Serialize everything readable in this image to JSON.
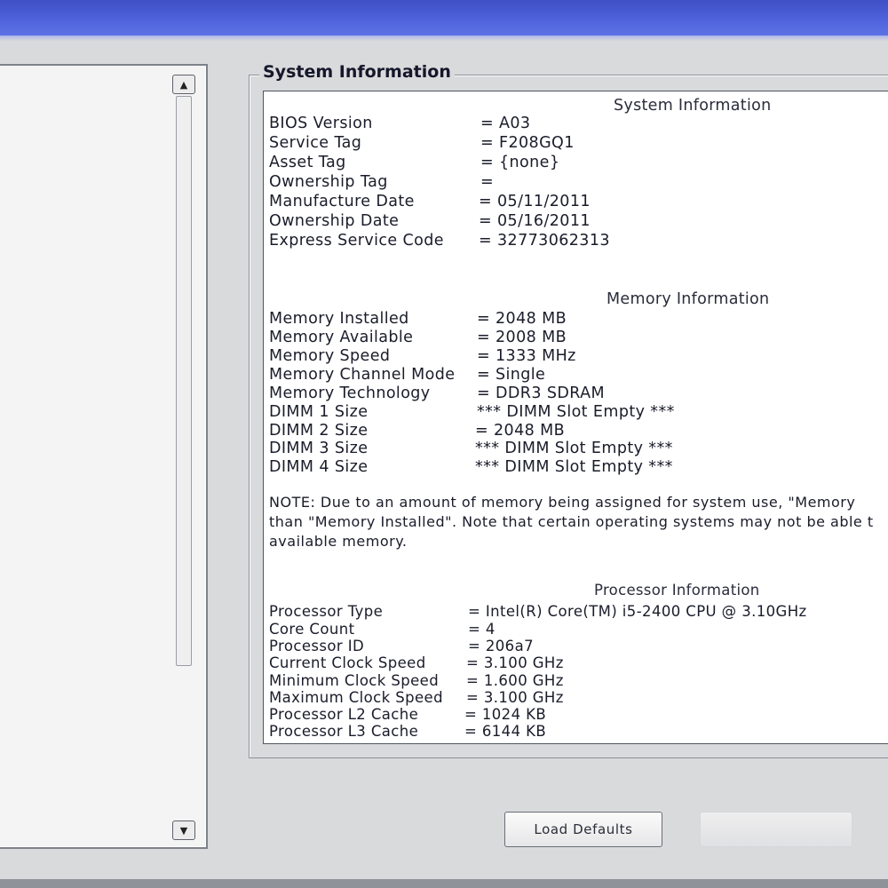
{
  "group": {
    "title": "System Information"
  },
  "system_info": {
    "heading": "System Information",
    "rows": [
      {
        "label": "BIOS Version",
        "value": "= A03"
      },
      {
        "label": "Service Tag",
        "value": "= F208GQ1"
      },
      {
        "label": "Asset Tag",
        "value": "= {none}"
      },
      {
        "label": "Ownership Tag",
        "value": "="
      },
      {
        "label": "Manufacture Date",
        "value": "= 05/11/2011"
      },
      {
        "label": "Ownership Date",
        "value": "= 05/16/2011"
      },
      {
        "label": "Express Service Code",
        "value": "= 32773062313"
      }
    ]
  },
  "memory_info": {
    "heading": "Memory Information",
    "rows": [
      {
        "label": "Memory Installed",
        "value": "= 2048 MB"
      },
      {
        "label": "Memory Available",
        "value": "= 2008 MB"
      },
      {
        "label": "Memory Speed",
        "value": "= 1333 MHz"
      },
      {
        "label": "Memory Channel Mode",
        "value": "= Single"
      },
      {
        "label": "Memory Technology",
        "value": "= DDR3 SDRAM"
      },
      {
        "label": "DIMM 1 Size",
        "value": "*** DIMM Slot Empty ***"
      },
      {
        "label": "DIMM 2 Size",
        "value": "= 2048 MB"
      },
      {
        "label": "DIMM 3 Size",
        "value": "*** DIMM Slot Empty ***"
      },
      {
        "label": "DIMM 4 Size",
        "value": "*** DIMM Slot Empty ***"
      }
    ],
    "note_lines": [
      "NOTE: Due to an amount of memory being assigned for system use, \"Memory",
      "than \"Memory Installed\". Note that certain operating systems may not be able t",
      "available memory."
    ]
  },
  "processor_info": {
    "heading": "Processor Information",
    "rows": [
      {
        "label": "Processor Type",
        "value": "= Intel(R) Core(TM) i5-2400 CPU @ 3.10GHz"
      },
      {
        "label": "Core Count",
        "value": "= 4"
      },
      {
        "label": "Processor ID",
        "value": "= 206a7"
      },
      {
        "label": "Current Clock Speed",
        "value": "= 3.100 GHz"
      },
      {
        "label": "Minimum Clock Speed",
        "value": "= 1.600 GHz"
      },
      {
        "label": "Maximum Clock Speed",
        "value": "= 3.100 GHz"
      },
      {
        "label": "Processor L2 Cache",
        "value": "= 1024 KB"
      },
      {
        "label": "Processor L3 Cache",
        "value": "= 6144 KB"
      }
    ]
  },
  "buttons": {
    "load_defaults": "Load Defaults"
  },
  "scrollbar": {
    "up_icon": "▲",
    "down_icon": "▼"
  },
  "colors": {
    "titlebar": "#4f63dc",
    "panel_bg": "#ffffff",
    "window_bg": "#d9dadc"
  }
}
